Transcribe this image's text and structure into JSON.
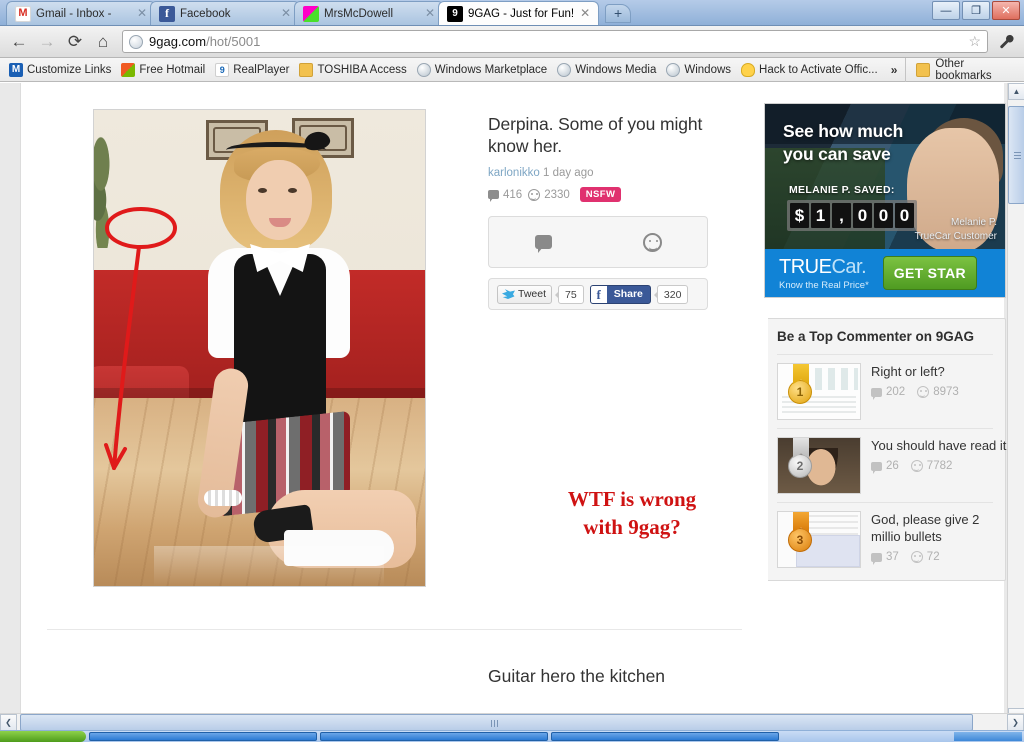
{
  "browser": {
    "tabs": [
      {
        "title": "Gmail - Inbox -",
        "favicon": "gmail-icon",
        "active": false
      },
      {
        "title": "Facebook",
        "favicon": "facebook-icon",
        "active": false
      },
      {
        "title": "MrsMcDowell",
        "favicon": "mrsmcdowell-icon",
        "active": false
      },
      {
        "title": "9GAG - Just for Fun!",
        "favicon": "9gag-icon",
        "active": true
      }
    ],
    "new_tab_label": "+",
    "window_controls": {
      "minimize": "—",
      "restore": "❐",
      "close": "✕"
    },
    "nav": {
      "back": "←",
      "forward": "→",
      "reload": "⟳",
      "home": "⌂"
    },
    "omnibox": {
      "domain": "9gag.com",
      "path": "/hot/5001",
      "star": "☆"
    },
    "wrench_label": "🔧",
    "bookmarks": [
      {
        "label": "Customize Links",
        "icon": "msn-icon"
      },
      {
        "label": "Free Hotmail",
        "icon": "windows-icon"
      },
      {
        "label": "RealPlayer",
        "icon": "realplayer-icon"
      },
      {
        "label": "TOSHIBA Access",
        "icon": "folder-icon"
      },
      {
        "label": "Windows Marketplace",
        "icon": "globe-icon"
      },
      {
        "label": "Windows Media",
        "icon": "globe-icon"
      },
      {
        "label": "Windows",
        "icon": "globe-icon"
      },
      {
        "label": "Hack to Activate Offic...",
        "icon": "bulb-icon"
      }
    ],
    "bookmarks_overflow": "»",
    "other_bookmarks": {
      "label": "Other bookmarks",
      "icon": "folder-icon"
    }
  },
  "post": {
    "title": "Derpina. Some of you might know her.",
    "author": "karlonikko",
    "time": "1 day ago",
    "comment_count": "416",
    "points": "2330",
    "nsfw_badge": "NSFW",
    "image_alt": "Blonde woman in black vest, white shirt and plaid skirt sitting on a wooden floor in front of a red sofa"
  },
  "reactions": {
    "comment_icon": "comment-icon",
    "smiley_icon": "smiley-icon"
  },
  "share": {
    "tweet_label": "Tweet",
    "tweet_count": "75",
    "facebook_label": "Share",
    "facebook_count": "320",
    "twitter_icon": "twitter-bird-icon",
    "facebook_icon": "facebook-f-icon"
  },
  "annotation": {
    "line1": "WTF is wrong",
    "line2": "with 9gag?",
    "color": "#cf1212"
  },
  "next_post": {
    "title": "Guitar hero the kitchen"
  },
  "ad": {
    "headline_line1": "See how much",
    "headline_line2": "you can save",
    "saved_label": "MELANIE P. SAVED:",
    "odometer": [
      "$",
      "1",
      ",",
      "0",
      "0",
      "0"
    ],
    "customer_name": "Melanie P.",
    "customer_role": "TrueCar Customer",
    "brand_true": "TRUE",
    "brand_car": "Car.",
    "tagline": "Know the Real Price*",
    "cta": "GET STAR",
    "brand_color": "#1183d6",
    "cta_color": "#5aa625"
  },
  "sidebar": {
    "panel_title": "Be a Top Commenter on 9GAG",
    "items": [
      {
        "rank": "1",
        "medal": "gold-medal-icon",
        "title": "Right or left?",
        "comments": "202",
        "points": "8973"
      },
      {
        "rank": "2",
        "medal": "silver-medal-icon",
        "title": "You should have read it",
        "comments": "26",
        "points": "7782"
      },
      {
        "rank": "3",
        "medal": "bronze-medal-icon",
        "title": "God, please give 2 millio bullets",
        "comments": "37",
        "points": "72"
      }
    ]
  },
  "scrollbars": {
    "up_arrow": "▲",
    "down_arrow": "▼",
    "left_arrow": "❮",
    "right_arrow": "❯"
  }
}
